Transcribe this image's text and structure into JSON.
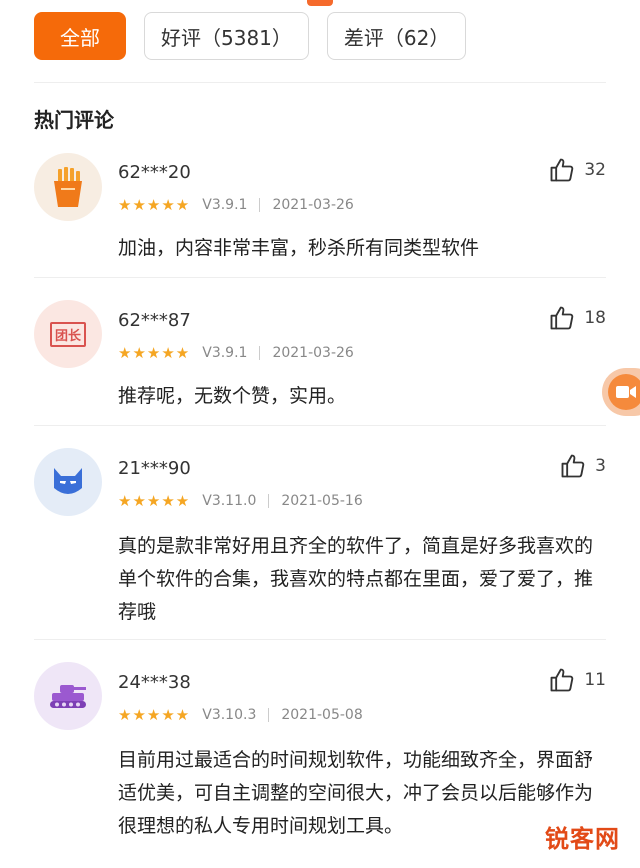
{
  "filters": [
    {
      "label": "全部",
      "active": true
    },
    {
      "label": "好评（5381）",
      "active": false
    },
    {
      "label": "差评（62）",
      "active": false
    }
  ],
  "section_title": "热门评论",
  "reviews": [
    {
      "user": "62***20",
      "stars": "★★★★★",
      "version": "V3.9.1",
      "date": "2021-03-26",
      "likes": "32",
      "content": "加油，内容非常丰富，秒杀所有同类型软件",
      "avatar_icon": "fries-icon"
    },
    {
      "user": "62***87",
      "stars": "★★★★★",
      "version": "V3.9.1",
      "date": "2021-03-26",
      "likes": "18",
      "content": "推荐呢，无数个赞，实用。",
      "avatar_icon": "tuanzhang-stamp-icon",
      "avatar_text": "团长"
    },
    {
      "user": "21***90",
      "stars": "★★★★★",
      "version": "V3.11.0",
      "date": "2021-05-16",
      "likes": "3",
      "content": "真的是款非常好用且齐全的软件了，简直是好多我喜欢的单个软件的合集，我喜欢的特点都在里面，爱了爱了，推荐哦",
      "avatar_icon": "batman-mask-icon"
    },
    {
      "user": "24***38",
      "stars": "★★★★★",
      "version": "V3.10.3",
      "date": "2021-05-08",
      "likes": "11",
      "content": "目前用过最适合的时间规划软件，功能细致齐全，界面舒适优美，可自主调整的空间很大，冲了会员以后能够作为很理想的私人专用时间规划工具。",
      "avatar_icon": "tank-icon"
    }
  ],
  "watermark": "锐客网",
  "colors": {
    "accent": "#f56a0a",
    "star": "#f5a623"
  }
}
